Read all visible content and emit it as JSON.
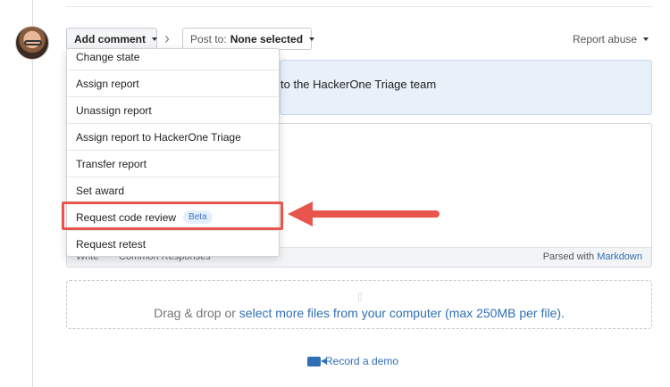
{
  "toolbar": {
    "add_comment_label": "Add comment",
    "post_to_prefix": "Post to:",
    "post_to_value": "None selected",
    "report_abuse_label": "Report abuse"
  },
  "notice": {
    "text": "to the HackerOne Triage team"
  },
  "menu": {
    "items": [
      {
        "label": "Change state"
      },
      {
        "label": "Assign report"
      },
      {
        "label": "Unassign report"
      },
      {
        "label": "Assign report to HackerOne Triage"
      },
      {
        "label": "Transfer report"
      },
      {
        "label": "Set award"
      },
      {
        "label": "Request code review",
        "badge": "Beta"
      },
      {
        "label": "Request retest"
      }
    ]
  },
  "editor": {
    "tab_write": "Write",
    "tab_responses": "Common Responses",
    "parsed_prefix": "Parsed with",
    "parsed_link": "Markdown"
  },
  "dropzone": {
    "text_prefix": "Drag & drop or",
    "link_text": "select more files from your computer (max 250MB per file)",
    "text_suffix": "."
  },
  "record": {
    "label": "Record a demo"
  },
  "colors": {
    "link": "#2f6fb5",
    "annotation": "#e8554d",
    "badge_bg": "#e5effb"
  }
}
